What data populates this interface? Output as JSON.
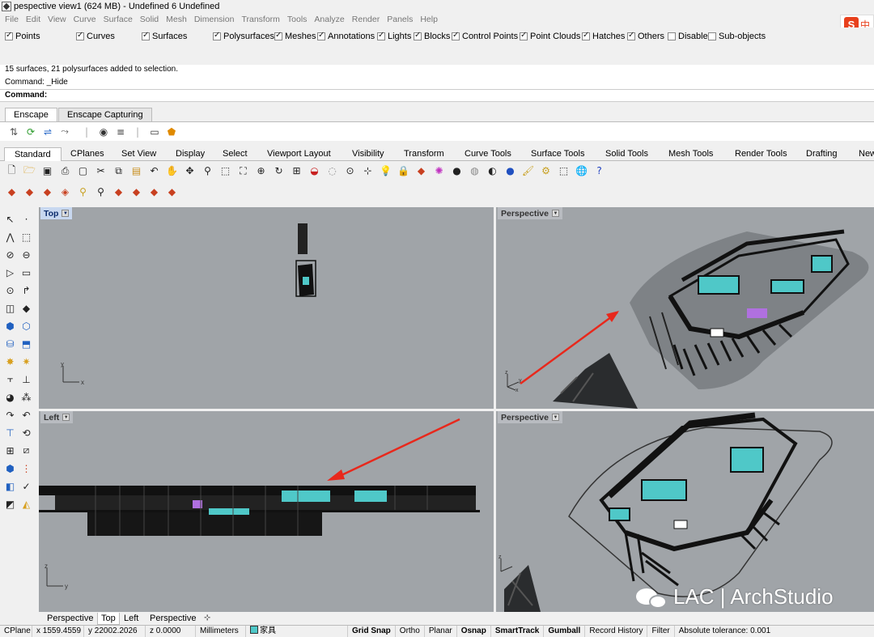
{
  "window": {
    "title": "pespective view1 (624 MB) - Undefined 6 Undefined"
  },
  "menu": [
    "File",
    "Edit",
    "View",
    "Curve",
    "Surface",
    "Solid",
    "Mesh",
    "Dimension",
    "Transform",
    "Tools",
    "Analyze",
    "Render",
    "Panels",
    "Help"
  ],
  "ime": {
    "logo": "S",
    "lang": "中"
  },
  "filters": [
    {
      "label": "Points",
      "checked": true
    },
    {
      "label": "Curves",
      "checked": true
    },
    {
      "label": "Surfaces",
      "checked": true
    },
    {
      "label": "Polysurfaces",
      "checked": true
    },
    {
      "label": "Meshes",
      "checked": true
    },
    {
      "label": "Annotations",
      "checked": true
    },
    {
      "label": "Lights",
      "checked": true
    },
    {
      "label": "Blocks",
      "checked": true
    },
    {
      "label": "Control Points",
      "checked": true
    },
    {
      "label": "Point Clouds",
      "checked": true
    },
    {
      "label": "Hatches",
      "checked": true
    },
    {
      "label": "Others",
      "checked": true
    },
    {
      "label": "Disable",
      "checked": false
    },
    {
      "label": "Sub-objects",
      "checked": false
    }
  ],
  "command_history": [
    "15 surfaces, 21 polysurfaces added to selection.",
    "Command: _Hide"
  ],
  "command_prompt": "Command:",
  "enscape_tabs": [
    {
      "label": "Enscape",
      "active": true
    },
    {
      "label": "Enscape Capturing",
      "active": false
    }
  ],
  "toolbar_tabs": [
    "Standard",
    "CPlanes",
    "Set View",
    "Display",
    "Select",
    "Viewport Layout",
    "Visibility",
    "Transform",
    "Curve Tools",
    "Surface Tools",
    "Solid Tools",
    "Mesh Tools",
    "Render Tools",
    "Drafting",
    "New"
  ],
  "viewports": [
    {
      "label": "Top",
      "active": true
    },
    {
      "label": "Perspective",
      "active": false
    },
    {
      "label": "Left",
      "active": false
    },
    {
      "label": "Perspective",
      "active": false
    }
  ],
  "viewport_tabs": [
    {
      "label": "Perspective",
      "active": false
    },
    {
      "label": "Top",
      "active": true
    },
    {
      "label": "Left",
      "active": false
    },
    {
      "label": "Perspective",
      "active": false
    }
  ],
  "add_tab_icon": "plus-icon",
  "status": {
    "cplane": "CPlane",
    "x": "x 1559.4559",
    "y": "y 22002.2026",
    "z": "z 0.0000",
    "units": "Millimeters",
    "layer": "家具",
    "layer_color": "#4fc8c8",
    "grid_snap": "Grid Snap",
    "ortho": "Ortho",
    "planar": "Planar",
    "osnap": "Osnap",
    "smarttrack": "SmartTrack",
    "gumball": "Gumball",
    "record_history": "Record History",
    "filter": "Filter",
    "tolerance": "Absolute tolerance: 0.001"
  },
  "watermark": "LAC | ArchStudio",
  "colors": {
    "viewport_bg": "#a0a4a8",
    "accent_cyan": "#4fc8c8",
    "arrow_red": "#e8281c"
  }
}
